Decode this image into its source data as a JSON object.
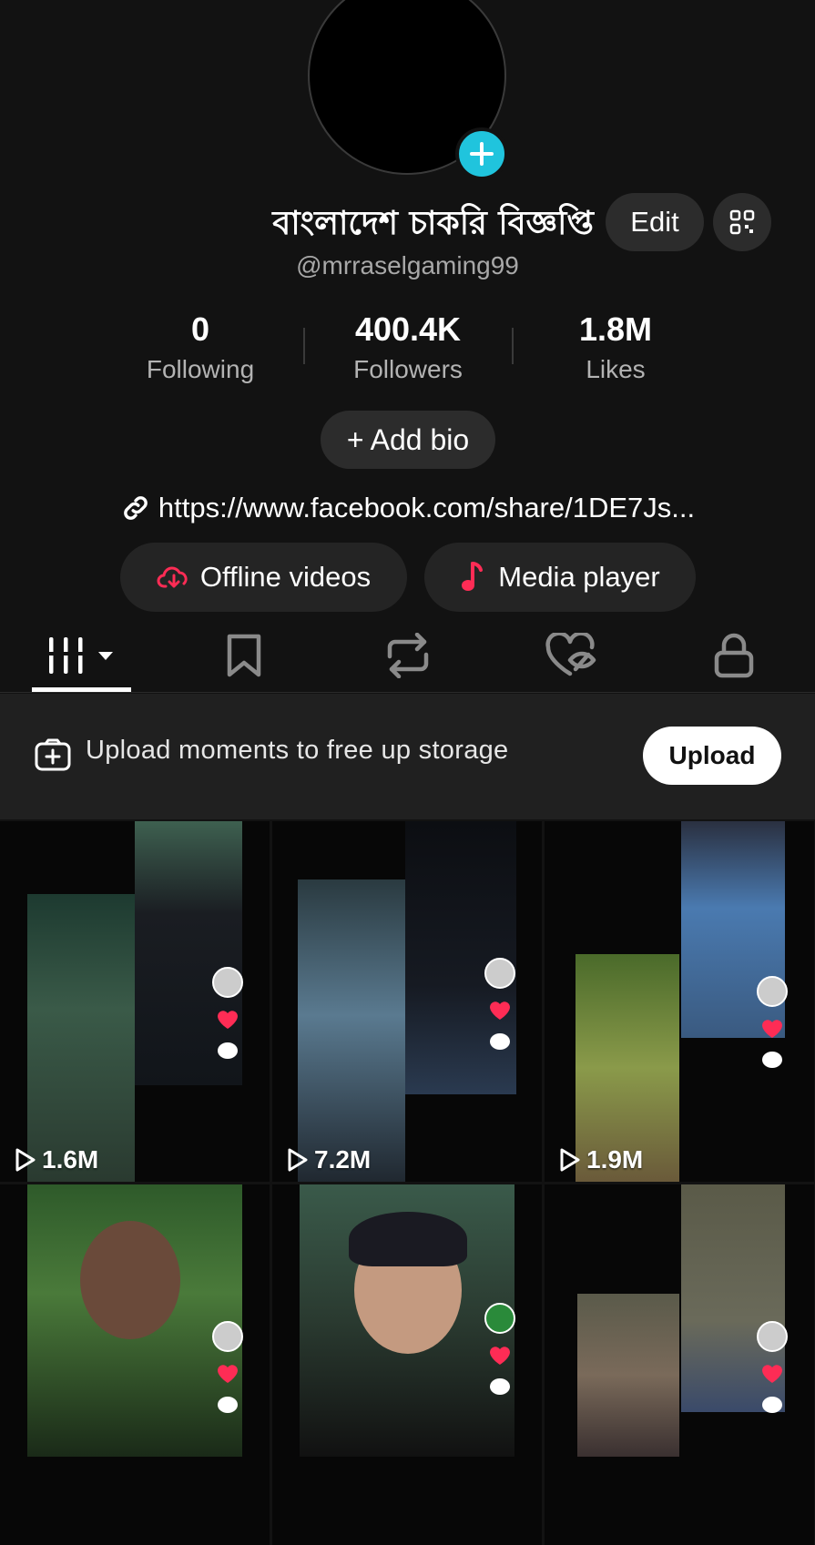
{
  "profile": {
    "display_name": "বাংলাদেশ চাকরি বিজ্ঞপ্তি",
    "username": "@mrraselgaming99",
    "edit_label": "Edit",
    "add_bio_label": "+ Add bio",
    "link": "https://www.facebook.com/share/1DE7Js..."
  },
  "stats": [
    {
      "value": "0",
      "label": "Following"
    },
    {
      "value": "400.4K",
      "label": "Followers"
    },
    {
      "value": "1.8M",
      "label": "Likes"
    }
  ],
  "pills": {
    "offline": "Offline videos",
    "media": "Media player"
  },
  "tabs": [
    "videos-grid-icon",
    "bookmark-icon",
    "repost-icon",
    "liked-hidden-icon",
    "lock-icon"
  ],
  "upload_banner": {
    "text": "Upload moments to free up storage",
    "button": "Upload"
  },
  "videos": [
    {
      "views": "1.6M"
    },
    {
      "views": "7.2M"
    },
    {
      "views": "1.9M"
    },
    {
      "views": ""
    },
    {
      "views": ""
    },
    {
      "views": ""
    }
  ],
  "colors": {
    "background": "#121212",
    "accent_cyan": "#20c4dd",
    "accent_red": "#fe2c55",
    "pill_bg": "#242424"
  }
}
